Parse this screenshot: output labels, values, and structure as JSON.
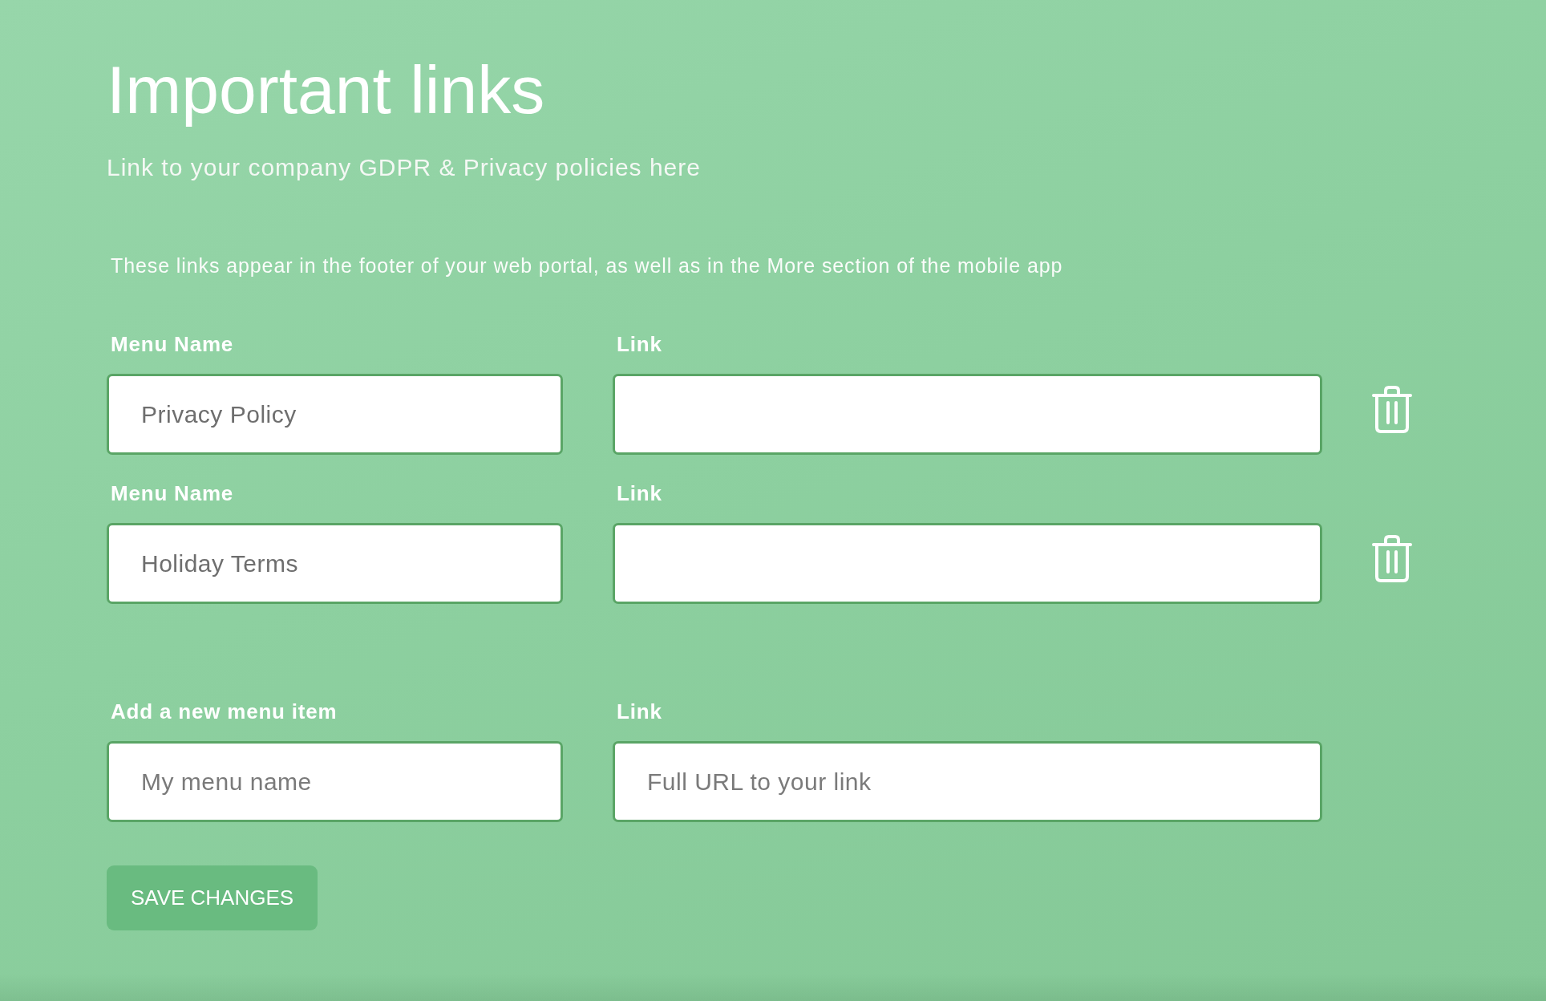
{
  "title": "Important links",
  "subtitle": "Link to your company GDPR & Privacy policies here",
  "description": "These links appear in the footer of your web portal, as well as in the More section of the mobile app",
  "links": [
    {
      "name_label": "Menu Name",
      "name_value": "Privacy Policy",
      "link_label": "Link"
    },
    {
      "name_label": "Menu Name",
      "name_value": "Holiday Terms",
      "link_label": "Link"
    }
  ],
  "new_item": {
    "name_label": "Add a new menu item",
    "name_placeholder": "My menu name",
    "link_label": "Link",
    "link_placeholder": "Full URL to your link"
  },
  "save_button": "SAVE CHANGES"
}
